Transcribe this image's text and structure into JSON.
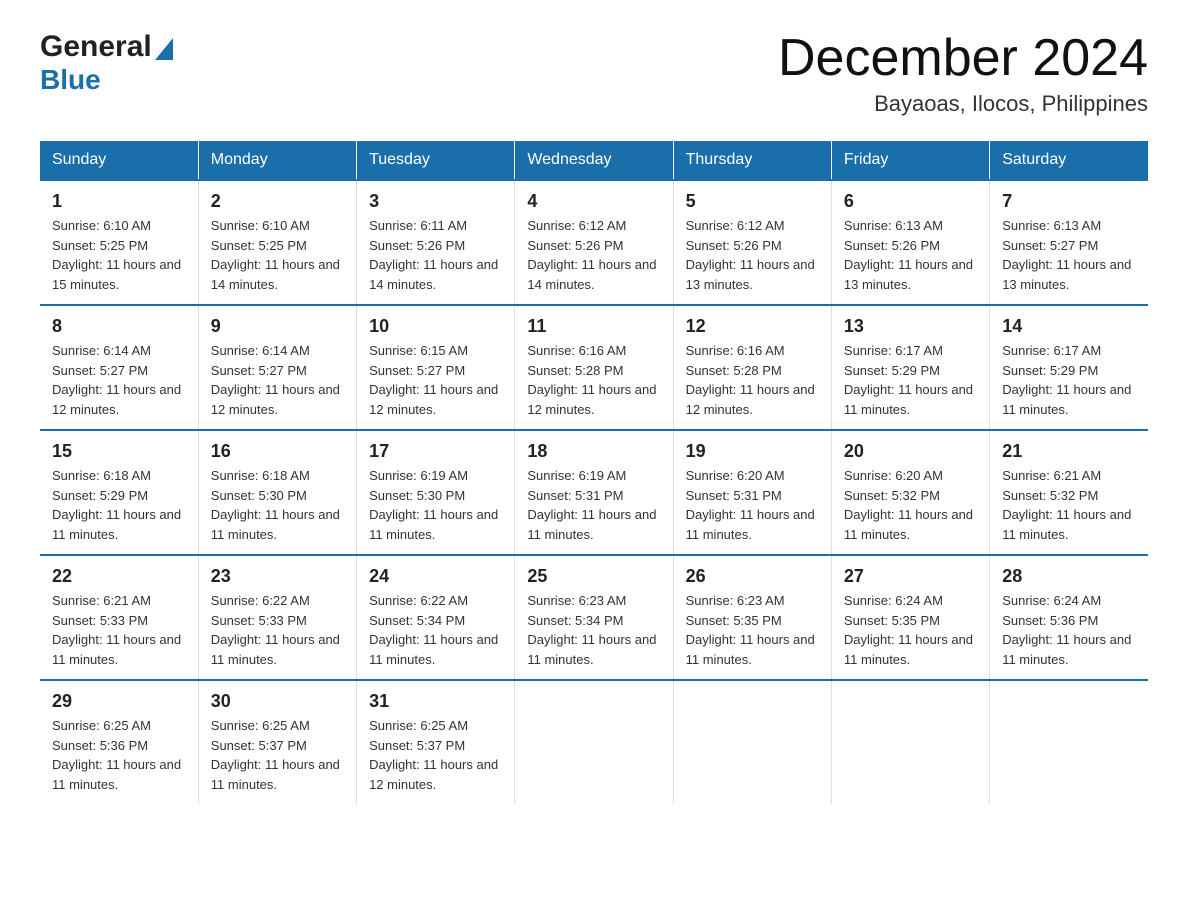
{
  "header": {
    "logo_general": "General",
    "logo_blue": "Blue",
    "title": "December 2024",
    "subtitle": "Bayaoas, Ilocos, Philippines"
  },
  "days": [
    "Sunday",
    "Monday",
    "Tuesday",
    "Wednesday",
    "Thursday",
    "Friday",
    "Saturday"
  ],
  "weeks": [
    [
      {
        "num": "1",
        "sunrise": "6:10 AM",
        "sunset": "5:25 PM",
        "daylight": "11 hours and 15 minutes."
      },
      {
        "num": "2",
        "sunrise": "6:10 AM",
        "sunset": "5:25 PM",
        "daylight": "11 hours and 14 minutes."
      },
      {
        "num": "3",
        "sunrise": "6:11 AM",
        "sunset": "5:26 PM",
        "daylight": "11 hours and 14 minutes."
      },
      {
        "num": "4",
        "sunrise": "6:12 AM",
        "sunset": "5:26 PM",
        "daylight": "11 hours and 14 minutes."
      },
      {
        "num": "5",
        "sunrise": "6:12 AM",
        "sunset": "5:26 PM",
        "daylight": "11 hours and 13 minutes."
      },
      {
        "num": "6",
        "sunrise": "6:13 AM",
        "sunset": "5:26 PM",
        "daylight": "11 hours and 13 minutes."
      },
      {
        "num": "7",
        "sunrise": "6:13 AM",
        "sunset": "5:27 PM",
        "daylight": "11 hours and 13 minutes."
      }
    ],
    [
      {
        "num": "8",
        "sunrise": "6:14 AM",
        "sunset": "5:27 PM",
        "daylight": "11 hours and 12 minutes."
      },
      {
        "num": "9",
        "sunrise": "6:14 AM",
        "sunset": "5:27 PM",
        "daylight": "11 hours and 12 minutes."
      },
      {
        "num": "10",
        "sunrise": "6:15 AM",
        "sunset": "5:27 PM",
        "daylight": "11 hours and 12 minutes."
      },
      {
        "num": "11",
        "sunrise": "6:16 AM",
        "sunset": "5:28 PM",
        "daylight": "11 hours and 12 minutes."
      },
      {
        "num": "12",
        "sunrise": "6:16 AM",
        "sunset": "5:28 PM",
        "daylight": "11 hours and 12 minutes."
      },
      {
        "num": "13",
        "sunrise": "6:17 AM",
        "sunset": "5:29 PM",
        "daylight": "11 hours and 11 minutes."
      },
      {
        "num": "14",
        "sunrise": "6:17 AM",
        "sunset": "5:29 PM",
        "daylight": "11 hours and 11 minutes."
      }
    ],
    [
      {
        "num": "15",
        "sunrise": "6:18 AM",
        "sunset": "5:29 PM",
        "daylight": "11 hours and 11 minutes."
      },
      {
        "num": "16",
        "sunrise": "6:18 AM",
        "sunset": "5:30 PM",
        "daylight": "11 hours and 11 minutes."
      },
      {
        "num": "17",
        "sunrise": "6:19 AM",
        "sunset": "5:30 PM",
        "daylight": "11 hours and 11 minutes."
      },
      {
        "num": "18",
        "sunrise": "6:19 AM",
        "sunset": "5:31 PM",
        "daylight": "11 hours and 11 minutes."
      },
      {
        "num": "19",
        "sunrise": "6:20 AM",
        "sunset": "5:31 PM",
        "daylight": "11 hours and 11 minutes."
      },
      {
        "num": "20",
        "sunrise": "6:20 AM",
        "sunset": "5:32 PM",
        "daylight": "11 hours and 11 minutes."
      },
      {
        "num": "21",
        "sunrise": "6:21 AM",
        "sunset": "5:32 PM",
        "daylight": "11 hours and 11 minutes."
      }
    ],
    [
      {
        "num": "22",
        "sunrise": "6:21 AM",
        "sunset": "5:33 PM",
        "daylight": "11 hours and 11 minutes."
      },
      {
        "num": "23",
        "sunrise": "6:22 AM",
        "sunset": "5:33 PM",
        "daylight": "11 hours and 11 minutes."
      },
      {
        "num": "24",
        "sunrise": "6:22 AM",
        "sunset": "5:34 PM",
        "daylight": "11 hours and 11 minutes."
      },
      {
        "num": "25",
        "sunrise": "6:23 AM",
        "sunset": "5:34 PM",
        "daylight": "11 hours and 11 minutes."
      },
      {
        "num": "26",
        "sunrise": "6:23 AM",
        "sunset": "5:35 PM",
        "daylight": "11 hours and 11 minutes."
      },
      {
        "num": "27",
        "sunrise": "6:24 AM",
        "sunset": "5:35 PM",
        "daylight": "11 hours and 11 minutes."
      },
      {
        "num": "28",
        "sunrise": "6:24 AM",
        "sunset": "5:36 PM",
        "daylight": "11 hours and 11 minutes."
      }
    ],
    [
      {
        "num": "29",
        "sunrise": "6:25 AM",
        "sunset": "5:36 PM",
        "daylight": "11 hours and 11 minutes."
      },
      {
        "num": "30",
        "sunrise": "6:25 AM",
        "sunset": "5:37 PM",
        "daylight": "11 hours and 11 minutes."
      },
      {
        "num": "31",
        "sunrise": "6:25 AM",
        "sunset": "5:37 PM",
        "daylight": "11 hours and 12 minutes."
      },
      null,
      null,
      null,
      null
    ]
  ],
  "labels": {
    "sunrise": "Sunrise:",
    "sunset": "Sunset:",
    "daylight": "Daylight:"
  }
}
